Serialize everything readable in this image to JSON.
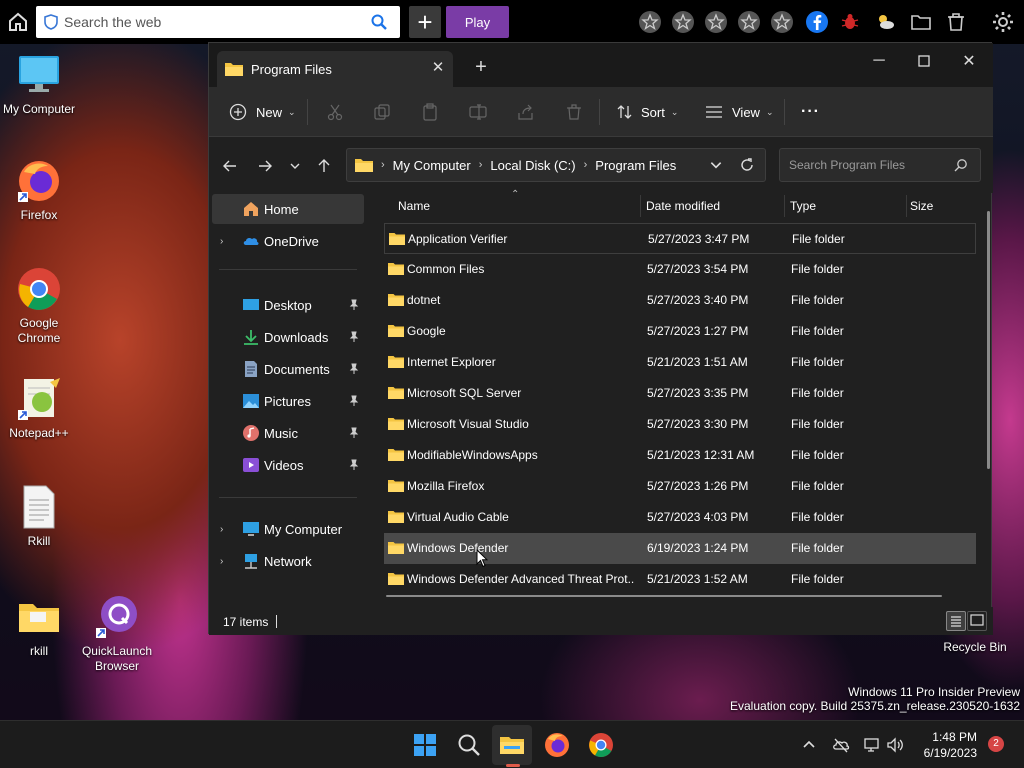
{
  "browser_bar": {
    "search_placeholder": "Search the web",
    "play_label": "Play"
  },
  "desktop_icons": [
    {
      "label": "My Computer"
    },
    {
      "label": "Firefox"
    },
    {
      "label": "Google Chrome"
    },
    {
      "label": "Notepad++"
    },
    {
      "label": "Rkill"
    },
    {
      "label": "rkill"
    },
    {
      "label": "QuickLaunch Browser"
    },
    {
      "label": "Recycle Bin"
    }
  ],
  "explorer": {
    "tab_title": "Program Files",
    "toolbar": {
      "new_label": "New",
      "sort_label": "Sort",
      "view_label": "View",
      "more_label": "···"
    },
    "address": {
      "segments": [
        "My Computer",
        "Local Disk (C:)",
        "Program Files"
      ]
    },
    "search_placeholder": "Search Program Files",
    "nav": {
      "home": "Home",
      "onedrive": "OneDrive",
      "desktop": "Desktop",
      "downloads": "Downloads",
      "documents": "Documents",
      "pictures": "Pictures",
      "music": "Music",
      "videos": "Videos",
      "my_computer": "My Computer",
      "network": "Network"
    },
    "columns": {
      "name": "Name",
      "date": "Date modified",
      "type": "Type",
      "size": "Size"
    },
    "rows": [
      {
        "name": "Application Verifier",
        "date": "5/27/2023 3:47 PM",
        "type": "File folder"
      },
      {
        "name": "Common Files",
        "date": "5/27/2023 3:54 PM",
        "type": "File folder"
      },
      {
        "name": "dotnet",
        "date": "5/27/2023 3:40 PM",
        "type": "File folder"
      },
      {
        "name": "Google",
        "date": "5/27/2023 1:27 PM",
        "type": "File folder"
      },
      {
        "name": "Internet Explorer",
        "date": "5/21/2023 1:51 AM",
        "type": "File folder"
      },
      {
        "name": "Microsoft SQL Server",
        "date": "5/27/2023 3:35 PM",
        "type": "File folder"
      },
      {
        "name": "Microsoft Visual Studio",
        "date": "5/27/2023 3:30 PM",
        "type": "File folder"
      },
      {
        "name": "ModifiableWindowsApps",
        "date": "5/21/2023 12:31 AM",
        "type": "File folder"
      },
      {
        "name": "Mozilla Firefox",
        "date": "5/27/2023 1:26 PM",
        "type": "File folder"
      },
      {
        "name": "Virtual Audio Cable",
        "date": "5/27/2023 4:03 PM",
        "type": "File folder"
      },
      {
        "name": "Windows Defender",
        "date": "6/19/2023 1:24 PM",
        "type": "File folder"
      },
      {
        "name": "Windows Defender Advanced Threat Prot...",
        "date": "5/21/2023 1:52 AM",
        "type": "File folder"
      }
    ],
    "status": {
      "item_count": "17 items"
    }
  },
  "watermark": {
    "line1": "Windows 11 Pro Insider Preview",
    "line2": "Evaluation copy. Build 25375.zn_release.230520-1632"
  },
  "taskbar": {
    "time": "1:48 PM",
    "date": "6/19/2023",
    "notification_count": "2"
  },
  "colors": {
    "accent_play": "#7a3ca6",
    "folder_yellow": "#f4c542",
    "window_bg": "#202020",
    "notification_badge": "#d64545"
  }
}
